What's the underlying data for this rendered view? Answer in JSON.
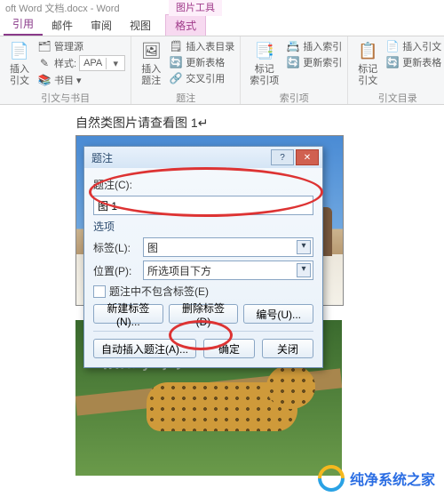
{
  "title": "oft Word 文档.docx - Word",
  "context_tool": "图片工具",
  "tabs": {
    "ref": "引用",
    "mail": "邮件",
    "review": "审阅",
    "view": "视图",
    "format": "格式"
  },
  "ribbon": {
    "g1": {
      "label": "引文与书目",
      "big": "插入引文",
      "r1": "管理源",
      "r2_prefix": "样式:",
      "r2_val": "APA",
      "r3": "书目"
    },
    "g2": {
      "label": "题注",
      "big": "插入题注",
      "r1": "插入表目录",
      "r2": "更新表格",
      "r3": "交叉引用"
    },
    "g3": {
      "label": "索引项",
      "big": "标记\n索引项",
      "r1": "插入索引",
      "r2": "更新索引"
    },
    "g4": {
      "label": "引文目录",
      "big": "标记引文",
      "r1": "插入引文",
      "r2": "更新表格"
    }
  },
  "doc": {
    "caption_text": "自然类图片请查看图 1"
  },
  "dialog": {
    "title": "题注",
    "caption_label": "题注(C):",
    "caption_value": "图 1",
    "options": "选项",
    "label_label": "标签(L):",
    "label_value": "图",
    "position_label": "位置(P):",
    "position_value": "所选项目下方",
    "exclude": "题注中不包含标签(E)",
    "new_label": "新建标签(N)...",
    "delete_label": "删除标签(D)",
    "numbering": "编号(U)...",
    "autocaption": "自动插入题注(A)...",
    "ok": "确定",
    "close": "关闭",
    "help": "?"
  },
  "watermark": "www.ywjzy.com",
  "footer": "纯净系统之家"
}
